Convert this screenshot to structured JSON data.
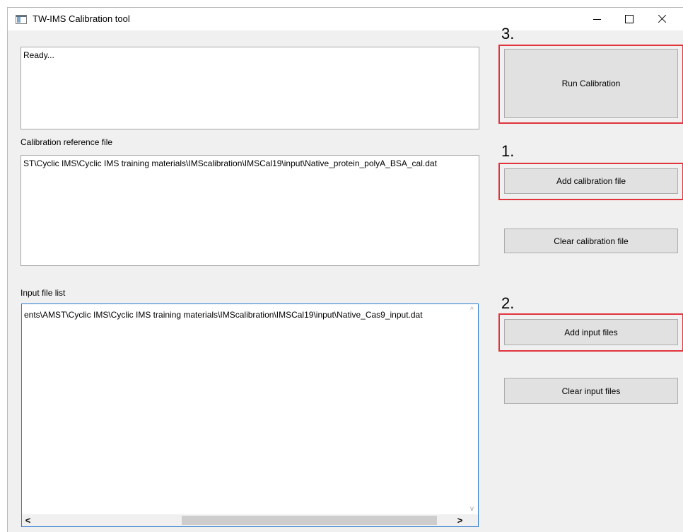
{
  "window": {
    "title": "TW-IMS Calibration tool",
    "controls": {
      "minimize": "minimize-icon",
      "maximize": "maximize-icon",
      "close": "close-icon"
    }
  },
  "status": {
    "text": "Ready..."
  },
  "calibration": {
    "label": "Calibration reference file",
    "path": "ST\\Cyclic IMS\\Cyclic IMS training materials\\IMScalibration\\IMSCal19\\input\\Native_protein_polyA_BSA_cal.dat"
  },
  "input": {
    "label": "Input file list",
    "files": [
      "ents\\AMST\\Cyclic IMS\\Cyclic IMS training materials\\IMScalibration\\IMSCal19\\input\\Native_Cas9_input.dat"
    ]
  },
  "buttons": {
    "run": "Run Calibration",
    "add_calibration": "Add calibration file",
    "clear_calibration": "Clear calibration file",
    "add_input": "Add input files",
    "clear_input": "Clear input files"
  },
  "steps": {
    "one": "1.",
    "two": "2.",
    "three": "3."
  },
  "scroll": {
    "up": "^",
    "down": "v",
    "left": "<",
    "right": ">"
  },
  "colors": {
    "highlight": "#e2343c",
    "list_focus_border": "#2f7bd2"
  }
}
